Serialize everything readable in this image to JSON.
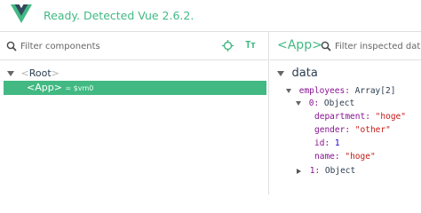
{
  "status": {
    "text": "Ready. Detected Vue 2.6.2."
  },
  "components_panel": {
    "search_placeholder": "Filter components",
    "tree": [
      {
        "name": "Root",
        "expanded": true,
        "selected": false
      },
      {
        "name": "App",
        "selected": true,
        "tag": "= $vm0"
      }
    ],
    "icons": [
      "target-icon",
      "text-format-icon"
    ]
  },
  "inspector_panel": {
    "component_name": "App",
    "search_placeholder": "Filter inspected data",
    "section": "data",
    "employees_key": "employees:",
    "employees_type": "Array[2]",
    "item0_key": "0:",
    "item0_type": "Object",
    "fields": [
      {
        "key": "department:",
        "value": "\"hoge\"",
        "kind": "string"
      },
      {
        "key": "gender:",
        "value": "\"other\"",
        "kind": "string"
      },
      {
        "key": "id:",
        "value": "1",
        "kind": "number"
      },
      {
        "key": "name:",
        "value": "\"hoge\"",
        "kind": "string"
      }
    ],
    "item1_key": "1:",
    "item1_type": "Object"
  },
  "colors": {
    "accent": "#42b983",
    "key": "#881391",
    "string": "#c41a16",
    "number": "#1c00cf"
  }
}
